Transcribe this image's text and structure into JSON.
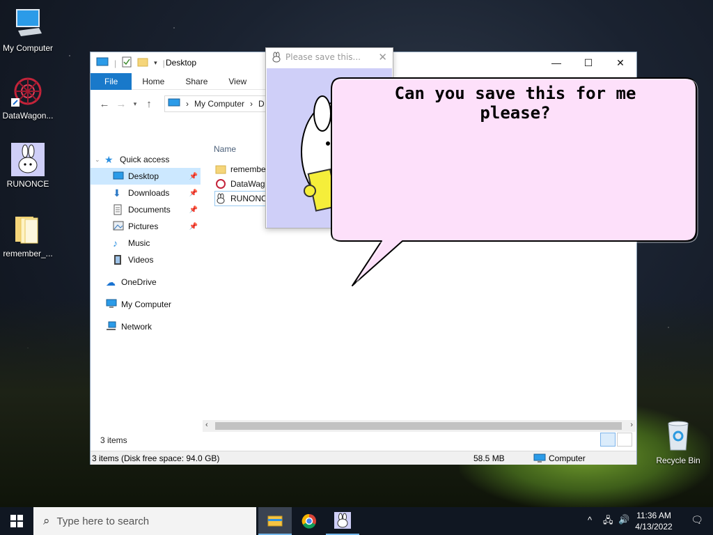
{
  "desktop": {
    "icons": [
      {
        "label": "My Computer"
      },
      {
        "label": "DataWagon..."
      },
      {
        "label": "RUNONCE"
      },
      {
        "label": "remember_..."
      },
      {
        "label": "Recycle Bin"
      }
    ]
  },
  "explorer": {
    "title": "Desktop",
    "tabs": [
      "File",
      "Home",
      "Share",
      "View"
    ],
    "address": {
      "root": "My Computer",
      "current": "D"
    },
    "nav": {
      "quick_access": "Quick access",
      "items": [
        {
          "label": "Desktop",
          "pinned": true
        },
        {
          "label": "Downloads",
          "pinned": true
        },
        {
          "label": "Documents",
          "pinned": true
        },
        {
          "label": "Pictures",
          "pinned": true
        },
        {
          "label": "Music",
          "pinned": false
        },
        {
          "label": "Videos",
          "pinned": false
        }
      ],
      "onedrive": "OneDrive",
      "computer": "My Computer",
      "network": "Network"
    },
    "files": {
      "column_name": "Name",
      "rows": [
        {
          "name": "remember"
        },
        {
          "name": "DataWago"
        },
        {
          "name": "RUNONCE"
        }
      ]
    },
    "item_count": "3 items",
    "status": {
      "left": "3 items (Disk free space: 94.0 GB)",
      "size": "58.5 MB",
      "location": "Computer"
    }
  },
  "popup": {
    "title": "Please save this..."
  },
  "bubble": {
    "text": "Can you save this for me please?"
  },
  "taskbar": {
    "search_placeholder": "Type here to search",
    "time": "11:36 AM",
    "date": "4/13/2022"
  },
  "colors": {
    "accent": "#1979ca",
    "bubble_fill": "#fde0fa",
    "popup_bg": "#cfcff8"
  }
}
